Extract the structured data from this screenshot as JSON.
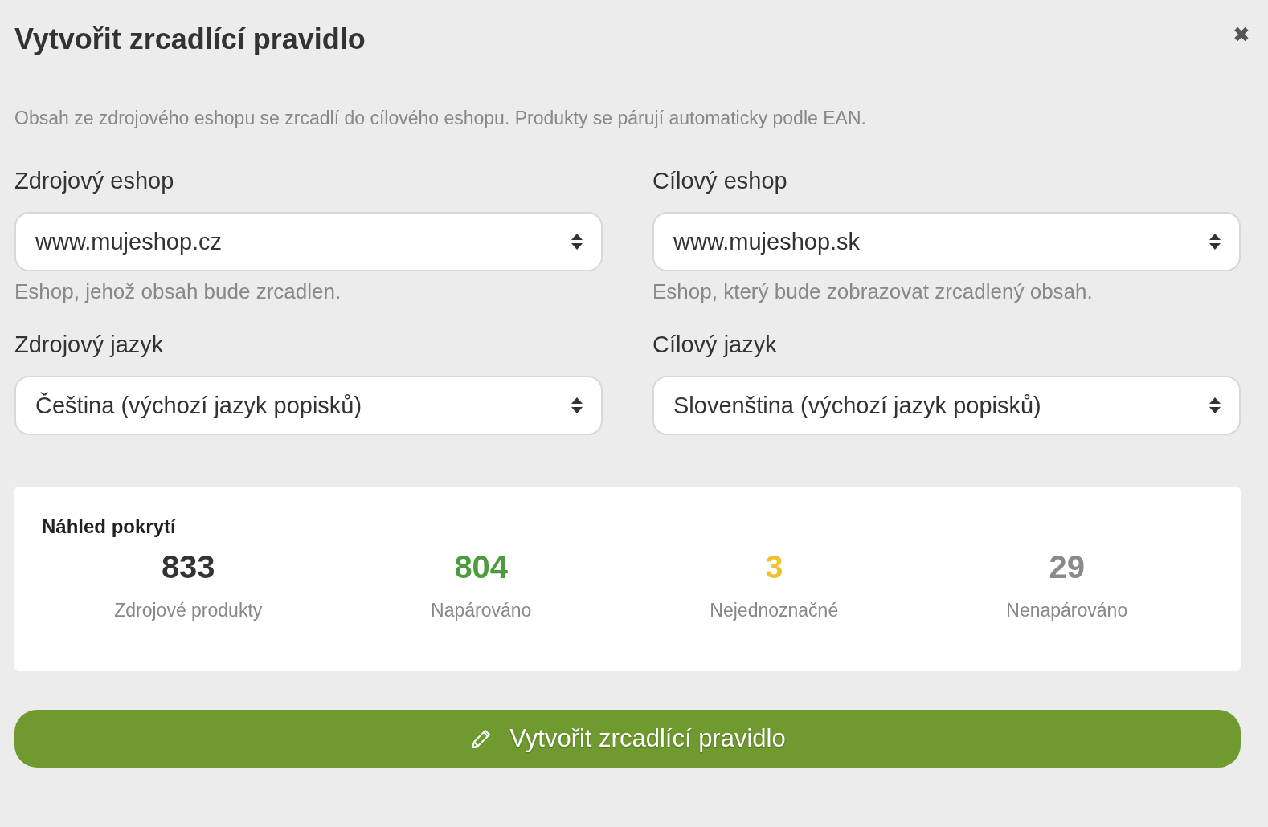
{
  "dialog": {
    "title": "Vytvořit zrcadlící pravidlo",
    "close": "✖",
    "description": "Obsah ze zdrojového eshopu se zrcadlí do cílového eshopu. Produkty se párují automaticky podle EAN.",
    "fields": [
      {
        "label": "Zdrojový eshop",
        "value": "www.mujeshop.cz",
        "hint": "Eshop, jehož obsah bude zrcadlen."
      },
      {
        "label": "Cílový eshop",
        "value": "www.mujeshop.sk",
        "hint": "Eshop, který bude zobrazovat zrcadlený obsah."
      },
      {
        "label": "Zdrojový jazyk",
        "value": "Čeština (výchozí jazyk popisků)"
      },
      {
        "label": "Cílový jazyk",
        "value": "Slovenština (výchozí jazyk popisků)"
      }
    ],
    "coverage": {
      "title": "Náhled pokrytí",
      "stats": [
        {
          "value": "833",
          "label": "Zdrojové produkty",
          "color": "#333333"
        },
        {
          "value": "804",
          "label": "Napárováno",
          "color": "#4e9a3e"
        },
        {
          "value": "3",
          "label": "Nejednoznačné",
          "color": "#f2c12e"
        },
        {
          "value": "29",
          "label": "Nenapárováno",
          "color": "#8a8a8a"
        }
      ]
    },
    "submit_button": "Vytvořit zrcadlící pravidlo"
  }
}
